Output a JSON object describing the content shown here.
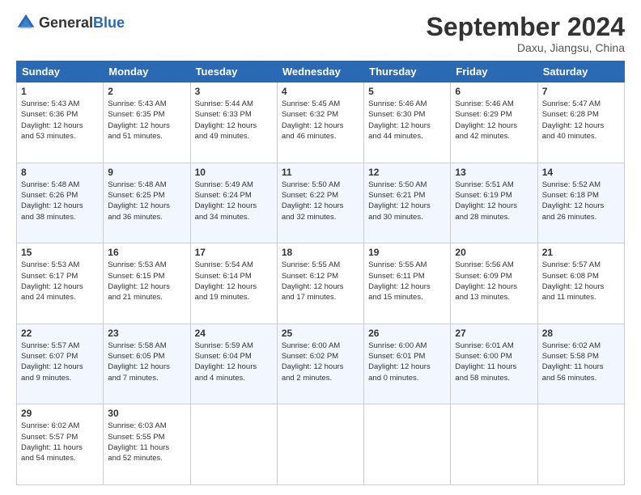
{
  "logo": {
    "general": "General",
    "blue": "Blue"
  },
  "header": {
    "month_year": "September 2024",
    "location": "Daxu, Jiangsu, China"
  },
  "weekdays": [
    "Sunday",
    "Monday",
    "Tuesday",
    "Wednesday",
    "Thursday",
    "Friday",
    "Saturday"
  ],
  "weeks": [
    [
      {
        "day": "1",
        "info": "Sunrise: 5:43 AM\nSunset: 6:36 PM\nDaylight: 12 hours\nand 53 minutes."
      },
      {
        "day": "2",
        "info": "Sunrise: 5:43 AM\nSunset: 6:35 PM\nDaylight: 12 hours\nand 51 minutes."
      },
      {
        "day": "3",
        "info": "Sunrise: 5:44 AM\nSunset: 6:33 PM\nDaylight: 12 hours\nand 49 minutes."
      },
      {
        "day": "4",
        "info": "Sunrise: 5:45 AM\nSunset: 6:32 PM\nDaylight: 12 hours\nand 46 minutes."
      },
      {
        "day": "5",
        "info": "Sunrise: 5:46 AM\nSunset: 6:30 PM\nDaylight: 12 hours\nand 44 minutes."
      },
      {
        "day": "6",
        "info": "Sunrise: 5:46 AM\nSunset: 6:29 PM\nDaylight: 12 hours\nand 42 minutes."
      },
      {
        "day": "7",
        "info": "Sunrise: 5:47 AM\nSunset: 6:28 PM\nDaylight: 12 hours\nand 40 minutes."
      }
    ],
    [
      {
        "day": "8",
        "info": "Sunrise: 5:48 AM\nSunset: 6:26 PM\nDaylight: 12 hours\nand 38 minutes."
      },
      {
        "day": "9",
        "info": "Sunrise: 5:48 AM\nSunset: 6:25 PM\nDaylight: 12 hours\nand 36 minutes."
      },
      {
        "day": "10",
        "info": "Sunrise: 5:49 AM\nSunset: 6:24 PM\nDaylight: 12 hours\nand 34 minutes."
      },
      {
        "day": "11",
        "info": "Sunrise: 5:50 AM\nSunset: 6:22 PM\nDaylight: 12 hours\nand 32 minutes."
      },
      {
        "day": "12",
        "info": "Sunrise: 5:50 AM\nSunset: 6:21 PM\nDaylight: 12 hours\nand 30 minutes."
      },
      {
        "day": "13",
        "info": "Sunrise: 5:51 AM\nSunset: 6:19 PM\nDaylight: 12 hours\nand 28 minutes."
      },
      {
        "day": "14",
        "info": "Sunrise: 5:52 AM\nSunset: 6:18 PM\nDaylight: 12 hours\nand 26 minutes."
      }
    ],
    [
      {
        "day": "15",
        "info": "Sunrise: 5:53 AM\nSunset: 6:17 PM\nDaylight: 12 hours\nand 24 minutes."
      },
      {
        "day": "16",
        "info": "Sunrise: 5:53 AM\nSunset: 6:15 PM\nDaylight: 12 hours\nand 21 minutes."
      },
      {
        "day": "17",
        "info": "Sunrise: 5:54 AM\nSunset: 6:14 PM\nDaylight: 12 hours\nand 19 minutes."
      },
      {
        "day": "18",
        "info": "Sunrise: 5:55 AM\nSunset: 6:12 PM\nDaylight: 12 hours\nand 17 minutes."
      },
      {
        "day": "19",
        "info": "Sunrise: 5:55 AM\nSunset: 6:11 PM\nDaylight: 12 hours\nand 15 minutes."
      },
      {
        "day": "20",
        "info": "Sunrise: 5:56 AM\nSunset: 6:09 PM\nDaylight: 12 hours\nand 13 minutes."
      },
      {
        "day": "21",
        "info": "Sunrise: 5:57 AM\nSunset: 6:08 PM\nDaylight: 12 hours\nand 11 minutes."
      }
    ],
    [
      {
        "day": "22",
        "info": "Sunrise: 5:57 AM\nSunset: 6:07 PM\nDaylight: 12 hours\nand 9 minutes."
      },
      {
        "day": "23",
        "info": "Sunrise: 5:58 AM\nSunset: 6:05 PM\nDaylight: 12 hours\nand 7 minutes."
      },
      {
        "day": "24",
        "info": "Sunrise: 5:59 AM\nSunset: 6:04 PM\nDaylight: 12 hours\nand 4 minutes."
      },
      {
        "day": "25",
        "info": "Sunrise: 6:00 AM\nSunset: 6:02 PM\nDaylight: 12 hours\nand 2 minutes."
      },
      {
        "day": "26",
        "info": "Sunrise: 6:00 AM\nSunset: 6:01 PM\nDaylight: 12 hours\nand 0 minutes."
      },
      {
        "day": "27",
        "info": "Sunrise: 6:01 AM\nSunset: 6:00 PM\nDaylight: 11 hours\nand 58 minutes."
      },
      {
        "day": "28",
        "info": "Sunrise: 6:02 AM\nSunset: 5:58 PM\nDaylight: 11 hours\nand 56 minutes."
      }
    ],
    [
      {
        "day": "29",
        "info": "Sunrise: 6:02 AM\nSunset: 5:57 PM\nDaylight: 11 hours\nand 54 minutes."
      },
      {
        "day": "30",
        "info": "Sunrise: 6:03 AM\nSunset: 5:55 PM\nDaylight: 11 hours\nand 52 minutes."
      },
      {
        "day": "",
        "info": ""
      },
      {
        "day": "",
        "info": ""
      },
      {
        "day": "",
        "info": ""
      },
      {
        "day": "",
        "info": ""
      },
      {
        "day": "",
        "info": ""
      }
    ]
  ]
}
